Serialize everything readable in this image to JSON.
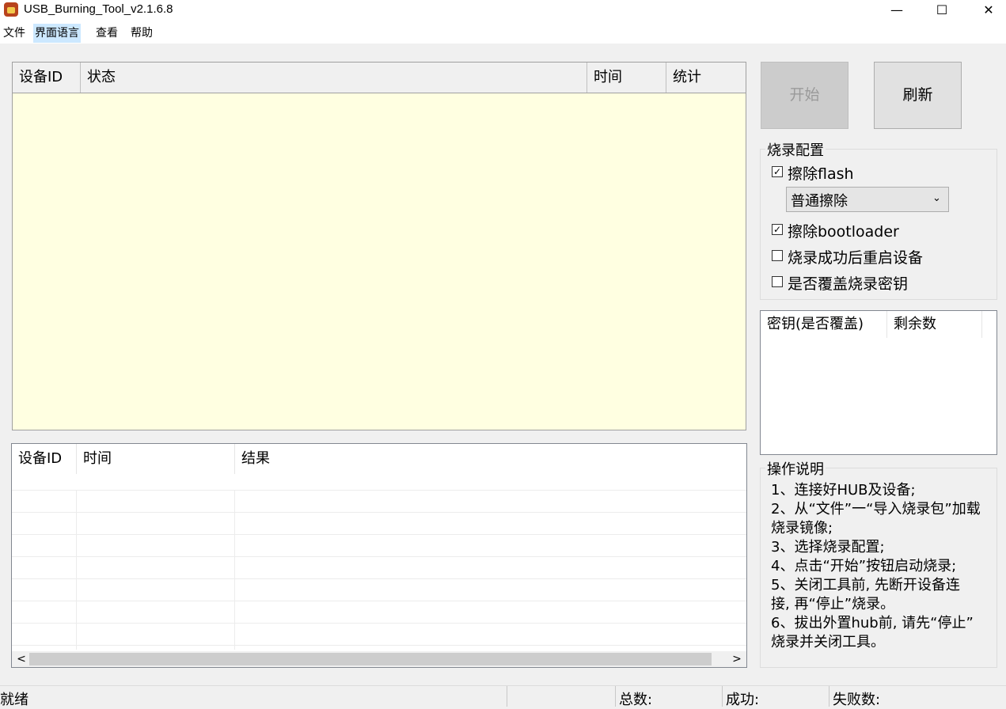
{
  "window": {
    "title": "USB_Burning_Tool_v2.1.6.8",
    "minimize_glyph": "—",
    "maximize_glyph": "☐",
    "close_glyph": "✕",
    "icon": "app-icon"
  },
  "menu": {
    "items": [
      {
        "label": "文件"
      },
      {
        "label": "界面语言"
      },
      {
        "label": "查看"
      },
      {
        "label": "帮助"
      }
    ]
  },
  "device_list": {
    "columns": [
      "设备ID",
      "状态",
      "时间",
      "统计"
    ],
    "background": "#ffffe1"
  },
  "result_list": {
    "columns": [
      "设备ID",
      "时间",
      "结果"
    ],
    "scroll_left": "<",
    "scroll_right": ">"
  },
  "buttons": {
    "start": "开始",
    "refresh": "刷新"
  },
  "burn_config": {
    "title": "烧录配置",
    "erase_flash": {
      "label": "擦除flash",
      "checked": true
    },
    "erase_mode": "普通擦除",
    "erase_bootloader": {
      "label": "擦除bootloader",
      "checked": true
    },
    "reboot_after": {
      "label": "烧录成功后重启设备",
      "checked": false
    },
    "overwrite_key": {
      "label": "是否覆盖烧录密钥",
      "checked": false
    }
  },
  "key_list": {
    "columns": [
      "密钥(是否覆盖)",
      "剩余数"
    ]
  },
  "instructions": {
    "title": "操作说明",
    "lines": [
      "1、连接好HUB及设备;",
      "2、从“文件”一“导入烧录包”加载",
      "烧录镜像;",
      "3、选择烧录配置;",
      "4、点击“开始”按钮启动烧录;",
      "5、关闭工具前, 先断开设备连",
      "接, 再“停止”烧录。",
      "6、拔出外置hub前, 请先“停止”",
      "烧录并关闭工具。"
    ]
  },
  "status": {
    "state": "就绪",
    "total_label": "总数:",
    "success_label": "成功:",
    "fail_label": "失败数:"
  }
}
